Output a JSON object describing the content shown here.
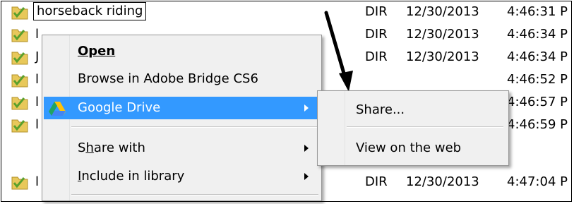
{
  "files": [
    {
      "name": "horseback riding",
      "type": "DIR",
      "date": "12/30/2013",
      "time": "4:46:31 P",
      "renaming": true
    },
    {
      "name": "l",
      "type": "DIR",
      "date": "12/30/2013",
      "time": "4:46:34 P"
    },
    {
      "name": "J",
      "type": "DIR",
      "date": "12/30/2013",
      "time": "4:46:34 P"
    },
    {
      "name": "l",
      "type": "",
      "date": "",
      "time": "4:46:52 P"
    },
    {
      "name": "l",
      "type": "",
      "date": "",
      "time": "4:46:57 P"
    },
    {
      "name": "l",
      "type": "",
      "date": "",
      "time": "4:46:59 P"
    },
    {
      "name": "l",
      "type": "DIR",
      "date": "12/30/2013",
      "time": "4:47:04 P"
    }
  ],
  "context_menu": {
    "open": "Open",
    "browse": "Browse in Adobe Bridge CS6",
    "google_drive": "Google Drive",
    "share_with_pre": "S",
    "share_with_u": "h",
    "share_with_post": "are with",
    "include_pre": "",
    "include_u": "I",
    "include_post": "nclude in library"
  },
  "submenu": {
    "share": "Share...",
    "view_web": "View on the web"
  },
  "colors": {
    "highlight": "#3399ff",
    "menu_bg": "#f0f0f0",
    "folder": "#e8c85a",
    "check": "#5aa02c"
  },
  "icons": {
    "folder": "folder-icon",
    "google_drive": "google-drive-icon",
    "submenu_arrow": "chevron-right-icon"
  }
}
